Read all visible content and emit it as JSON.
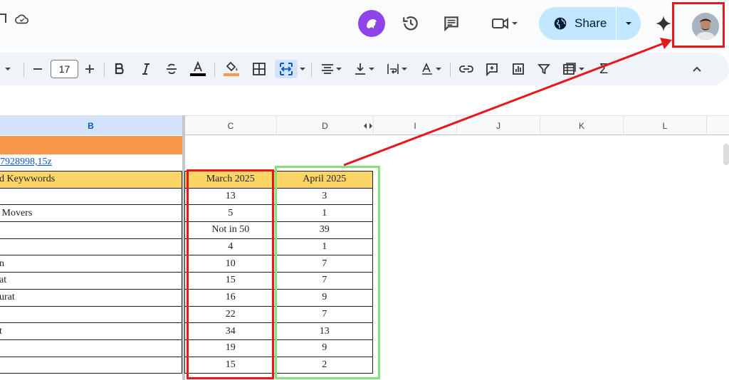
{
  "topbar": {
    "share_label": "Share"
  },
  "toolbar": {
    "font_size": "17",
    "sum_symbol": "Σ"
  },
  "columns": [
    {
      "id": "B",
      "selected": true
    },
    {
      "id": "C",
      "selected": false
    },
    {
      "id": "D",
      "selected": false
    },
    {
      "id": "I",
      "selected": false
    },
    {
      "id": "J",
      "selected": false
    },
    {
      "id": "K",
      "selected": false
    },
    {
      "id": "L",
      "selected": false
    }
  ],
  "sheet": {
    "link_text": "7928998,15z",
    "column_b_header": "d Keywwords",
    "column_b_values": [
      "",
      "Movers",
      "",
      "",
      "n",
      "at",
      "urat",
      "",
      "t",
      "",
      ""
    ],
    "march_header": "March 2025",
    "april_header": "April 2025",
    "march_values": [
      "13",
      "5",
      "Not in 50",
      "4",
      "10",
      "15",
      "16",
      "22",
      "34",
      "19",
      "15"
    ],
    "april_values": [
      "3",
      "1",
      "39",
      "1",
      "7",
      "7",
      "9",
      "7",
      "13",
      "9",
      "2"
    ]
  },
  "colors": {
    "annotation_red": "#e5181d",
    "annotation_green": "#7ee576",
    "header_fill": "#fcd567",
    "orange_fill": "#f7974c",
    "share_bg": "#c2e7ff"
  }
}
